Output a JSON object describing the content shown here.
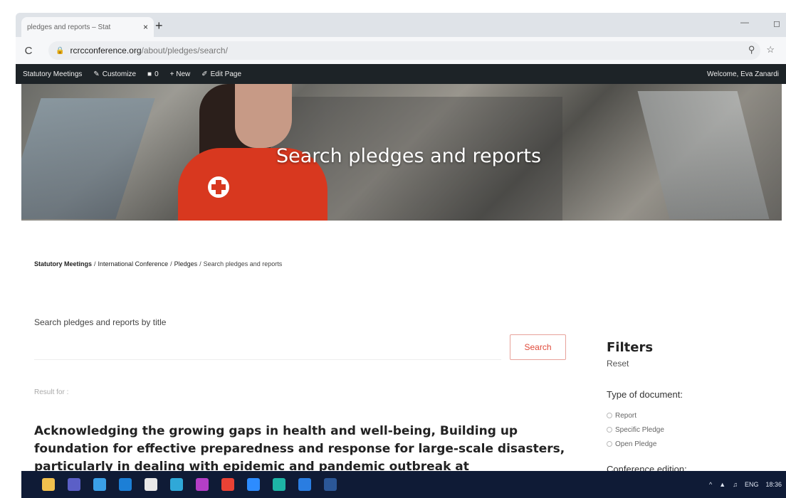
{
  "browser": {
    "tab_title": "pledges and reports – Stat",
    "tab_close": "×",
    "new_tab": "+",
    "url_host": "rcrcconference.org",
    "url_path": "/about/pledges/search/",
    "reload": "C",
    "min": "—",
    "max": "◻"
  },
  "adminbar": {
    "items": [
      "Statutory Meetings",
      "Customize",
      "0",
      "+ New",
      "Edit Page"
    ],
    "welcome": "Welcome, Eva Zanardi"
  },
  "hero": {
    "title": "Search pledges and reports"
  },
  "breadcrumb": {
    "items": [
      "Statutory Meetings",
      "International Conference",
      "Pledges",
      "Search pledges and reports"
    ],
    "sep": "/"
  },
  "search": {
    "label": "Search pledges and reports by title",
    "placeholder": "",
    "button": "Search",
    "result_for": "Result for :"
  },
  "result": {
    "title": "Acknowledging the growing gaps in health and well-being, Building up foundation for effective preparedness and response for large-scale disasters, particularly in dealing with epidemic and pandemic outbreak at"
  },
  "filters": {
    "title": "Filters",
    "reset": "Reset",
    "type_label": "Type of document:",
    "options": [
      "Report",
      "Specific Pledge",
      "Open Pledge"
    ],
    "edition_label": "Conference edition:"
  },
  "taskbar": {
    "icons": [
      {
        "name": "file-explorer-icon",
        "color": "#f2c14e"
      },
      {
        "name": "teams-icon",
        "color": "#5b5fc7"
      },
      {
        "name": "internet-explorer-icon",
        "color": "#3aa0e8"
      },
      {
        "name": "outlook-icon",
        "color": "#1c7fd6"
      },
      {
        "name": "store-icon",
        "color": "#e8e8e8"
      },
      {
        "name": "edge-icon",
        "color": "#2fa8d8"
      },
      {
        "name": "onenote-icon",
        "color": "#b43ec6"
      },
      {
        "name": "chrome-icon",
        "color": "#e94235"
      },
      {
        "name": "zoom-icon",
        "color": "#2d8cff"
      },
      {
        "name": "edge-dev-icon",
        "color": "#1db5a6"
      },
      {
        "name": "mail-icon",
        "color": "#2a7de1"
      },
      {
        "name": "word-icon",
        "color": "#2b5797"
      }
    ],
    "lang": "ENG",
    "time": "18:36"
  }
}
